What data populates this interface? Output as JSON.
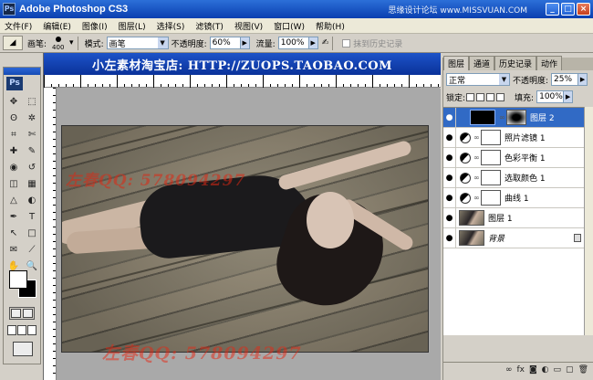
{
  "window": {
    "title": "Adobe Photoshop CS3",
    "watermark": "思缘设计论坛 www.MISSVUAN.COM",
    "buttons": {
      "minimize": "_",
      "maximize": "□",
      "close": "×"
    }
  },
  "menu": [
    "文件(F)",
    "编辑(E)",
    "图像(I)",
    "图层(L)",
    "选择(S)",
    "滤镜(T)",
    "视图(V)",
    "窗口(W)",
    "帮助(H)"
  ],
  "options": {
    "brush_label": "画笔:",
    "brush_size": "400",
    "mode_label": "模式:",
    "mode_value": "画笔",
    "opacity_label": "不透明度:",
    "opacity_value": "60%",
    "flow_label": "流量:",
    "flow_value": "100%",
    "history_label": "抹到历史记录"
  },
  "document": {
    "title": "小左素材淘宝店: HTTP://ZUOPS.TAOBAO.COM",
    "watermark_1": "左春QQ: 578094297",
    "watermark_2": "左春QQ: 578094297"
  },
  "toolbox": {
    "logo": "Ps",
    "tools": [
      "move-tool",
      "marquee-tool",
      "lasso-tool",
      "magic-wand-tool",
      "crop-tool",
      "slice-tool",
      "healing-brush-tool",
      "brush-tool",
      "clone-stamp-tool",
      "history-brush-tool",
      "eraser-tool",
      "gradient-tool",
      "blur-tool",
      "dodge-tool",
      "pen-tool",
      "type-tool",
      "path-selection-tool",
      "shape-tool",
      "notes-tool",
      "eyedropper-tool",
      "hand-tool",
      "zoom-tool"
    ],
    "icons": [
      "✥",
      "⬚",
      "ʘ",
      "✲",
      "⌗",
      "✄",
      "✚",
      "✎",
      "◉",
      "↺",
      "◫",
      "▦",
      "△",
      "◐",
      "✒",
      "T",
      "↖",
      "□",
      "✉",
      "⟋",
      "✋",
      "🔍"
    ]
  },
  "panel": {
    "tabs": [
      "图层",
      "通道",
      "历史记录",
      "动作"
    ],
    "blend_mode": "正常",
    "opacity_label": "不透明度:",
    "opacity_value": "25%",
    "lock_label": "锁定:",
    "fill_label": "填充:",
    "fill_value": "100%",
    "layers": [
      {
        "name": "图层 2",
        "type": "pixel-mask",
        "selected": true
      },
      {
        "name": "照片滤镜 1",
        "type": "adjustment",
        "selected": false
      },
      {
        "name": "色彩平衡 1",
        "type": "adjustment",
        "selected": false
      },
      {
        "name": "选取颜色 1",
        "type": "adjustment",
        "selected": false
      },
      {
        "name": "曲线 1",
        "type": "adjustment",
        "selected": false
      },
      {
        "name": "图层 1",
        "type": "pixel",
        "selected": false
      },
      {
        "name": "背景",
        "type": "background",
        "selected": false
      }
    ],
    "footer": [
      "∞",
      "fx",
      "◙",
      "◐",
      "▭",
      "▢",
      "🗑"
    ]
  }
}
